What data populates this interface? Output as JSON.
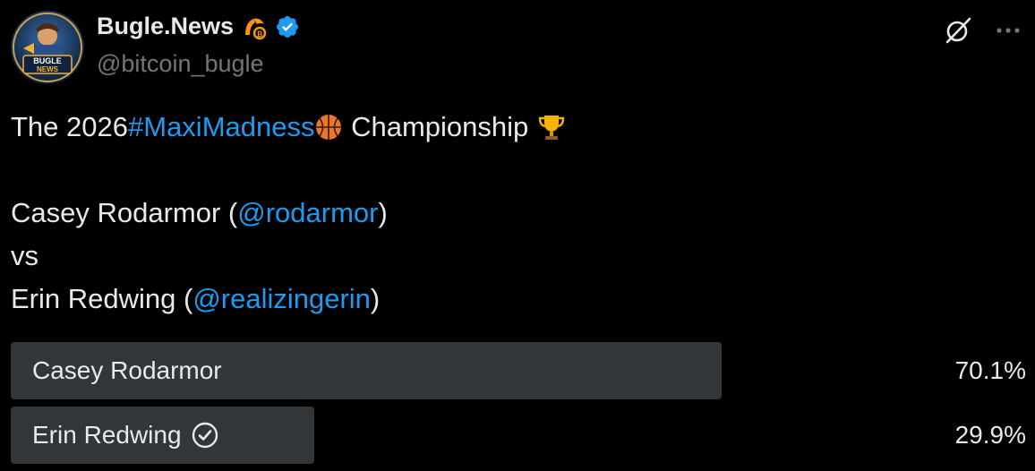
{
  "author": {
    "display_name": "Bugle.News",
    "handle": "@bitcoin_bugle",
    "avatar_text": "BUGLE NEWS",
    "badge_icon": "bitcoin-horn-icon",
    "verified_icon": "verified-badge-icon",
    "verified_color": "#1d9bf0"
  },
  "actions": {
    "grok_icon": "grok-icon",
    "more_icon": "more-icon"
  },
  "tweet": {
    "line1": {
      "prefix": "The 2026 ",
      "hashtag": "#MaxiMadness",
      "emoji_basketball": "basketball-icon",
      "suffix": " Championship ",
      "emoji_trophy": "trophy-icon"
    },
    "line2": {
      "name": "Casey Rodarmor (",
      "mention": "@rodarmor",
      "close": ")"
    },
    "line3": "vs",
    "line4": {
      "name": "Erin Redwing (",
      "mention": "@realizingerin",
      "close": ")"
    }
  },
  "poll": {
    "options": [
      {
        "label": "Casey Rodarmor",
        "percent_text": "70.1%",
        "percent": 70.1,
        "selected": false
      },
      {
        "label": "Erin Redwing",
        "percent_text": "29.9%",
        "percent": 29.9,
        "selected": true
      }
    ],
    "bar_color": "#333639",
    "selected_icon": "check-circle-icon"
  },
  "colors": {
    "background": "#000000",
    "text": "#e7e9ea",
    "secondary": "#71767b",
    "link": "#1d9bf0"
  }
}
